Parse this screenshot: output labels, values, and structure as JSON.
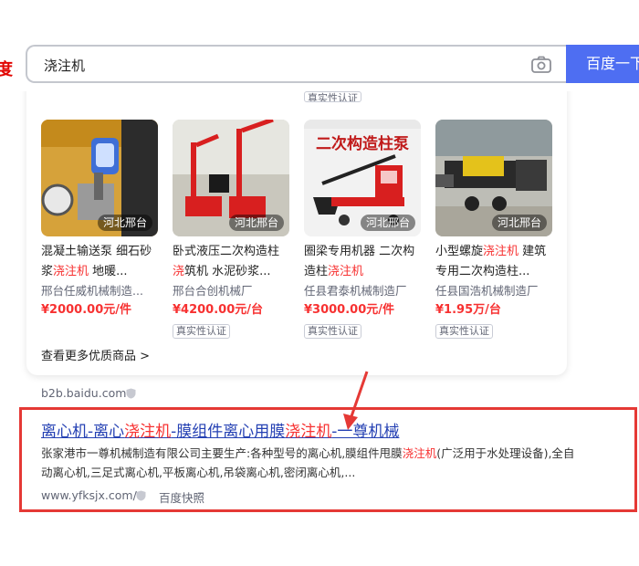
{
  "header": {
    "logo_fragment": "度",
    "search_value": "浇注机",
    "search_button": "百度一下"
  },
  "product_card": {
    "top_badge": "真实性认证",
    "products": [
      {
        "region": "河北邢台",
        "title_parts": [
          "混凝土输送泵 细石砂浆",
          "浇注机",
          " 地暖..."
        ],
        "seller": "邢台任威机械制造...",
        "price": "¥2000.00元/件",
        "badge": ""
      },
      {
        "region": "河北邢台",
        "title_parts": [
          "卧式液压二次构造柱",
          "浇",
          "筑机 水泥砂浆..."
        ],
        "seller": "邢台合创机械厂",
        "price": "¥4200.00元/台",
        "badge": "真实性认证"
      },
      {
        "region": "河北邢台",
        "title_parts": [
          "圈梁专用机器 二次构造柱",
          "浇注机",
          ""
        ],
        "seller": "任县君泰机械制造厂",
        "price": "¥3000.00元/件",
        "badge": "真实性认证",
        "image_text": "二次构造柱泵"
      },
      {
        "region": "河北邢台",
        "title_parts": [
          "小型螺旋",
          "浇注机",
          " 建筑专用二次构造柱..."
        ],
        "seller": "任县国浩机械制造厂",
        "price": "¥1.95万/台",
        "badge": "真实性认证"
      }
    ],
    "more_link": "查看更多优质商品 >"
  },
  "result": {
    "source": "b2b.baidu.com",
    "title_parts": [
      "离心机-离心",
      "浇注机",
      "-膜组件离心用膜",
      "浇注机",
      "-一尊机械"
    ],
    "desc_parts": [
      "张家港市一尊机械制造有限公司主要生产:各种型号的离心机,膜组件甩膜",
      "浇注机",
      "(广泛用于水处理设备),全自动离心机,三足式离心机,平板离心机,吊袋离心机,密闭离心机,..."
    ],
    "url": "www.yfksjx.com/",
    "snapshot": "百度快照"
  },
  "colors": {
    "brand_blue": "#4e6ef2",
    "highlight_red": "#f73131",
    "link_blue": "#2440b3",
    "annotation_red": "#e53935"
  }
}
